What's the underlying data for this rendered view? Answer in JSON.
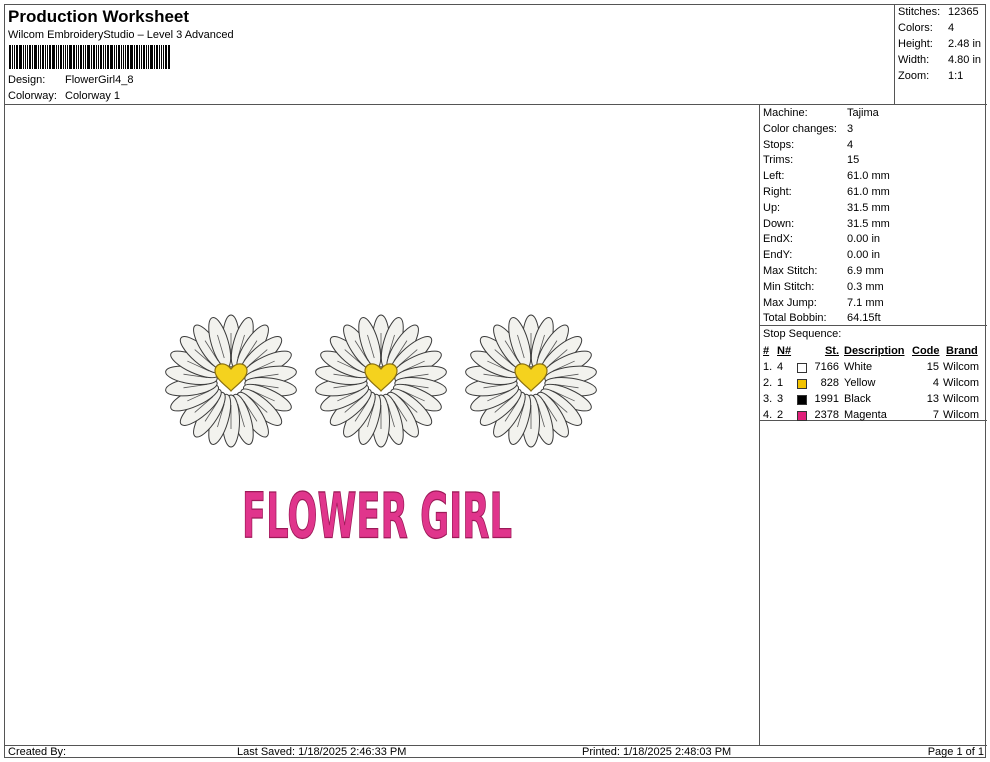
{
  "header": {
    "title": "Production Worksheet",
    "subtitle": "Wilcom EmbroideryStudio – Level 3 Advanced",
    "design_label": "Design:",
    "design_value": "FlowerGirl4_8",
    "colorway_label": "Colorway:",
    "colorway_value": "Colorway 1"
  },
  "stats": {
    "stitches_label": "Stitches:",
    "stitches_value": "12365",
    "colors_label": "Colors:",
    "colors_value": "4",
    "height_label": "Height:",
    "height_value": "2.48 in",
    "width_label": "Width:",
    "width_value": "4.80 in",
    "zoom_label": "Zoom:",
    "zoom_value": "1:1"
  },
  "machine_info": [
    {
      "label": "Machine:",
      "value": "Tajima"
    },
    {
      "label": "Color changes:",
      "value": "3"
    },
    {
      "label": "Stops:",
      "value": "4"
    },
    {
      "label": "Trims:",
      "value": "15"
    },
    {
      "label": "Left:",
      "value": "61.0 mm"
    },
    {
      "label": "Right:",
      "value": "61.0 mm"
    },
    {
      "label": "Up:",
      "value": "31.5 mm"
    },
    {
      "label": "Down:",
      "value": "31.5 mm"
    },
    {
      "label": "EndX:",
      "value": "0.00 in"
    },
    {
      "label": "EndY:",
      "value": "0.00 in"
    },
    {
      "label": "Max Stitch:",
      "value": "6.9 mm"
    },
    {
      "label": "Min Stitch:",
      "value": "0.3 mm"
    },
    {
      "label": "Max Jump:",
      "value": "7.1 mm"
    },
    {
      "label": "Total Bobbin:",
      "value": "64.15ft"
    }
  ],
  "stop_sequence": {
    "title": "Stop Sequence:",
    "headers": [
      "#",
      "N#",
      "St.",
      "Description",
      "Code",
      "Brand"
    ],
    "rows": [
      {
        "num": "1.",
        "n": "4",
        "color": "#ffffff",
        "st": "7166",
        "desc": "White",
        "code": "15",
        "brand": "Wilcom"
      },
      {
        "num": "2.",
        "n": "1",
        "color": "#f2c200",
        "st": "828",
        "desc": "Yellow",
        "code": "4",
        "brand": "Wilcom"
      },
      {
        "num": "3.",
        "n": "3",
        "color": "#000000",
        "st": "1991",
        "desc": "Black",
        "code": "13",
        "brand": "Wilcom"
      },
      {
        "num": "4.",
        "n": "2",
        "color": "#e0207a",
        "st": "2378",
        "desc": "Magenta",
        "code": "7",
        "brand": "Wilcom"
      }
    ]
  },
  "design": {
    "text": "FLOWER GIRL",
    "text_color": "#e0358c",
    "flower_count": 3,
    "petal_color": "#f2f2ee",
    "center_color": "#f4d21e"
  },
  "footer": {
    "created_by": "Created By:",
    "last_saved": "Last Saved: 1/18/2025 2:46:33 PM",
    "printed": "Printed: 1/18/2025 2:48:03 PM",
    "page": "Page 1 of 1"
  }
}
